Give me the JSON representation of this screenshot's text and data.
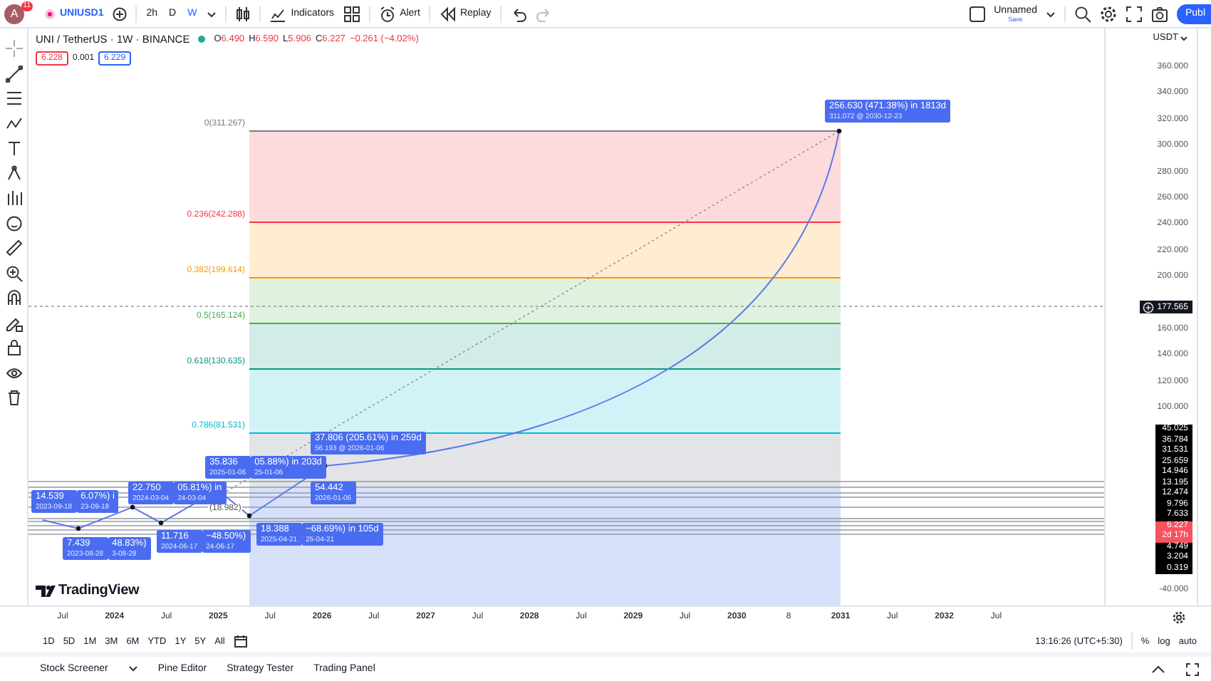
{
  "toolbar": {
    "avatar": "A",
    "notifications": "11",
    "symbol": "UNIUSD1",
    "intervals": [
      {
        "label": "2h",
        "selected": false
      },
      {
        "label": "D",
        "selected": false
      },
      {
        "label": "W",
        "selected": true
      }
    ],
    "buttons": [
      "Indicators",
      "Alert",
      "Replay"
    ],
    "layout": {
      "name": "Unnamed",
      "status": "Save"
    },
    "publish": "Publ"
  },
  "legend": {
    "title": "UNI / TetherUS · 1W · BINANCE",
    "ohlc": [
      {
        "key": "O",
        "value": "6.490"
      },
      {
        "key": "H",
        "value": "6.590"
      },
      {
        "key": "L",
        "value": "5.906"
      },
      {
        "key": "C",
        "value": "6.227"
      }
    ],
    "change": "−0.261 (−4.02%)",
    "bid": "6.228",
    "spread": "0.001",
    "ask": "6.229"
  },
  "currency": "USDT",
  "fib_levels": [
    {
      "label": "0(311.267)",
      "color": "#787b86"
    },
    {
      "label": "0.236(242.288)",
      "color": "#f23645"
    },
    {
      "label": "0.382(199.614)",
      "color": "#ff9800"
    },
    {
      "label": "0.5(165.124)",
      "color": "#4caf50"
    },
    {
      "label": "0.618(130.635)",
      "color": "#089981"
    },
    {
      "label": "0.786(81.531)",
      "color": "#00bcd4"
    }
  ],
  "annotations": [
    {
      "lines": [
        "256.630 (471.38%) in 1813d",
        "311.072 @ 2030-12-23"
      ]
    },
    {
      "lines": [
        "37.806 (205.61%) in 259d",
        "56.193 @ 2026-01-06"
      ]
    },
    {
      "lines": [
        "54.442",
        "2026-01-06"
      ]
    },
    {
      "lines": [
        "35.836",
        "2025-01-06"
      ]
    },
    {
      "lines": [
        "05.88%) in 203d",
        "25-01-06"
      ]
    },
    {
      "lines": [
        "22.750",
        "2024-03-04"
      ]
    },
    {
      "lines": [
        "05.81%) in",
        "24-03-04"
      ]
    },
    {
      "lines": [
        "14.539",
        "2023-09-18"
      ]
    },
    {
      "lines": [
        "6.07%) i",
        "23-09-18"
      ]
    },
    {
      "lines": [
        "7.439",
        "2023-08-28"
      ]
    },
    {
      "lines": [
        "48.83%)",
        "3-08-28"
      ]
    },
    {
      "lines": [
        "11.716",
        "2024-06-17"
      ]
    },
    {
      "lines": [
        "−48.50%)",
        "24-06-17"
      ]
    },
    {
      "lines": [
        "18.388",
        "2025-04-21"
      ]
    },
    {
      "lines": [
        "−68.69%) in 105d",
        "25-04-21"
      ]
    }
  ],
  "chart_note": "(18.982)",
  "price_scale": [
    "360.000",
    "340.000",
    "320.000",
    "300.000",
    "280.000",
    "260.000",
    "240.000",
    "220.000",
    "200.000",
    "160.000",
    "140.000",
    "120.000",
    "100.000",
    "-40.000"
  ],
  "price_tags": [
    {
      "kind": "crosshair",
      "text": "177.565"
    },
    {
      "kind": "level",
      "text": "45.025"
    },
    {
      "kind": "level",
      "text": "36.784"
    },
    {
      "kind": "level",
      "text": "31.531"
    },
    {
      "kind": "level",
      "text": "25.659"
    },
    {
      "kind": "level",
      "text": "14.946"
    },
    {
      "kind": "level",
      "text": "13.195"
    },
    {
      "kind": "level",
      "text": "12.474"
    },
    {
      "kind": "level",
      "text": "9.796"
    },
    {
      "kind": "level",
      "text": "7.633"
    },
    {
      "kind": "last",
      "text": "6.227",
      "sub": "2d 17h"
    },
    {
      "kind": "level",
      "text": "4.749"
    },
    {
      "kind": "level",
      "text": "3.204"
    },
    {
      "kind": "level",
      "text": "0.319"
    }
  ],
  "time_scale": [
    {
      "label": "Jul",
      "major": false
    },
    {
      "label": "2024",
      "major": true
    },
    {
      "label": "Jul",
      "major": false
    },
    {
      "label": "2025",
      "major": true
    },
    {
      "label": "Jul",
      "major": false
    },
    {
      "label": "2026",
      "major": true
    },
    {
      "label": "Jul",
      "major": false
    },
    {
      "label": "2027",
      "major": true
    },
    {
      "label": "Jul",
      "major": false
    },
    {
      "label": "2028",
      "major": true
    },
    {
      "label": "Jul",
      "major": false
    },
    {
      "label": "2029",
      "major": true
    },
    {
      "label": "Jul",
      "major": false
    },
    {
      "label": "2030",
      "major": true
    },
    {
      "label": "8",
      "major": false
    },
    {
      "label": "2031",
      "major": true
    },
    {
      "label": "Jul",
      "major": false
    },
    {
      "label": "2032",
      "major": true
    },
    {
      "label": "Jul",
      "major": false
    }
  ],
  "ranges": [
    "1D",
    "5D",
    "1M",
    "3M",
    "6M",
    "YTD",
    "1Y",
    "5Y",
    "All"
  ],
  "clock": "13:16:26 (UTC+5:30)",
  "scale_options": [
    "%",
    "log",
    "auto"
  ],
  "bottom_tabs": [
    "Stock Screener",
    "Pine Editor",
    "Strategy Tester",
    "Trading Panel"
  ],
  "logo": "TradingView"
}
